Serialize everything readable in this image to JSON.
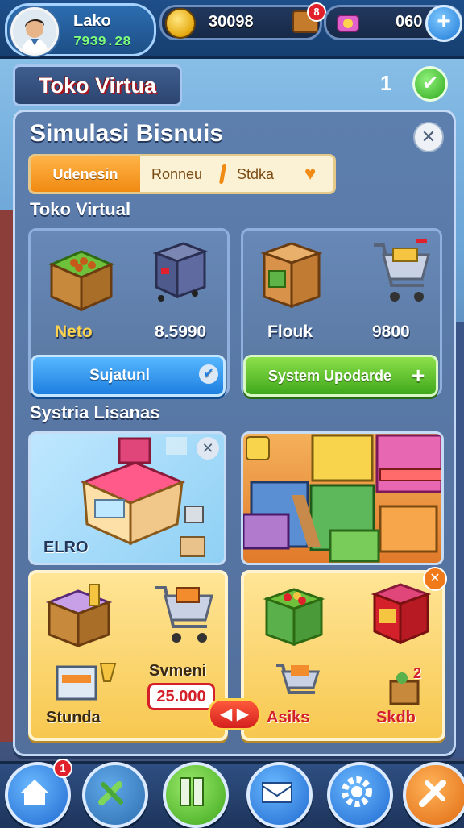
{
  "player": {
    "name": "Lako",
    "money": "7939.28"
  },
  "currencies": {
    "coins": "30098",
    "coin_badge": "8",
    "gems": "060"
  },
  "shop": {
    "title": "Toko Virtua",
    "count": "1"
  },
  "panel": {
    "title": "Simulasi Bisnuis",
    "tabs": [
      {
        "label": "Udenesin"
      },
      {
        "label": "Ronneu"
      },
      {
        "label": "Stdka"
      }
    ],
    "section1": "Toko Virtual",
    "section2": "Systria Lisanas",
    "cards": [
      {
        "label": "Neto",
        "value": "8.5990",
        "button": "Sujatunl"
      },
      {
        "label": "Flouk",
        "value": "9800",
        "button": "System Upodarde"
      }
    ],
    "scenes": [
      {
        "caption": "ELRO"
      },
      {
        "caption": ""
      }
    ],
    "market": [
      {
        "top_label": "Svmeni",
        "price": "25.000",
        "bottom_label": "Stunda"
      },
      {
        "badge": "2",
        "bottom_label_a": "Asiks",
        "bottom_label_b": "Skdb"
      }
    ]
  },
  "nav": {
    "home_badge": "1"
  },
  "icons": [
    "user-avatar",
    "coin-icon",
    "gem-icon",
    "plus-icon",
    "check-icon",
    "close-icon",
    "heart-icon",
    "home-icon",
    "tools-icon",
    "map-icon",
    "mail-icon",
    "settings-icon",
    "build-icon"
  ]
}
